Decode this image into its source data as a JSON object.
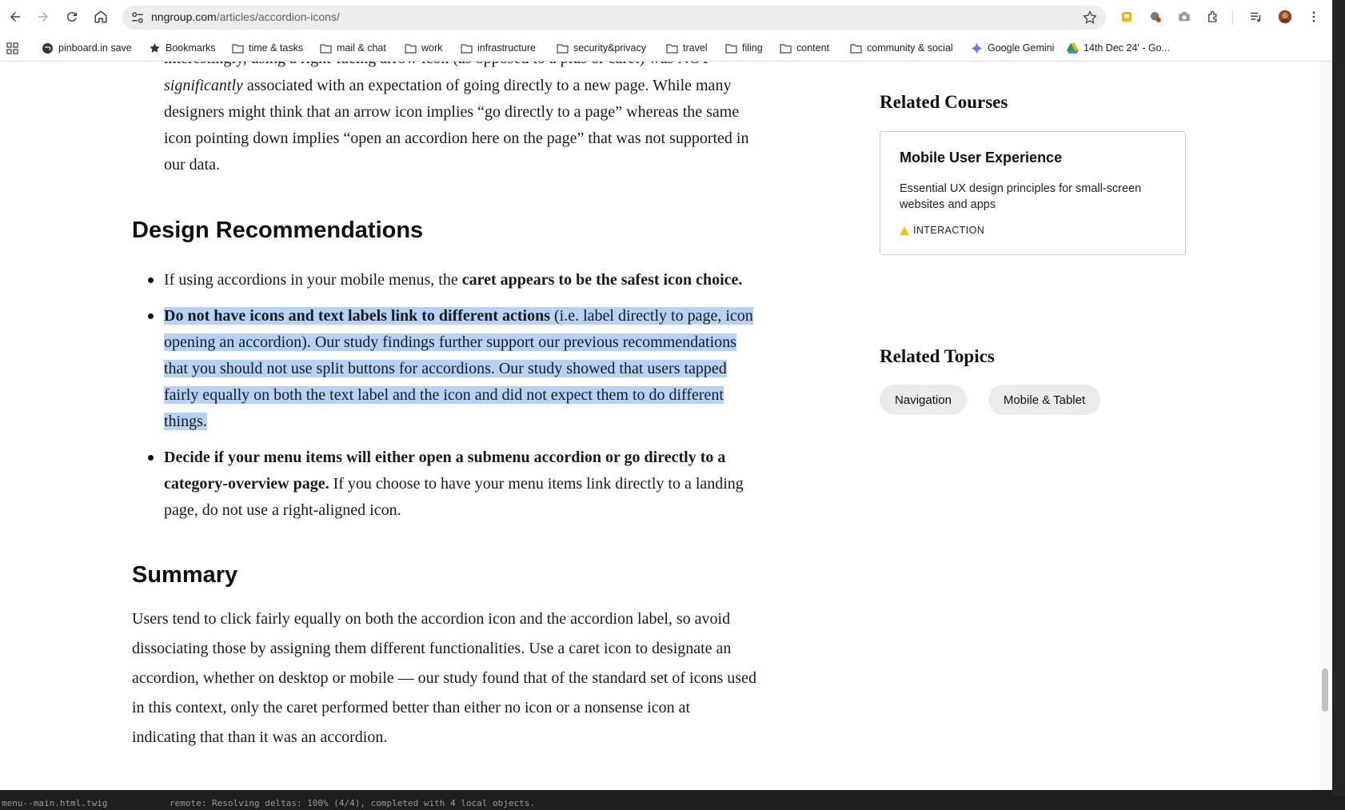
{
  "browser": {
    "url_host": "nngroup.com",
    "url_path": "/articles/accordion-icons/",
    "bookmarks": [
      {
        "label": "pinboard.in save",
        "icon": "globe-icon"
      },
      {
        "label": "Bookmarks",
        "icon": "star-icon"
      },
      {
        "label": "time & tasks",
        "icon": "folder-icon"
      },
      {
        "label": "mail & chat",
        "icon": "folder-icon"
      },
      {
        "label": "work",
        "icon": "folder-icon"
      },
      {
        "label": "infrastructure",
        "icon": "folder-icon"
      },
      {
        "label": "security&privacy",
        "icon": "folder-icon"
      },
      {
        "label": "travel",
        "icon": "folder-icon"
      },
      {
        "label": "filing",
        "icon": "folder-icon"
      },
      {
        "label": "content",
        "icon": "folder-icon"
      },
      {
        "label": "community & social",
        "icon": "folder-icon"
      },
      {
        "label": "Google Gemini",
        "icon": "gemini-icon"
      },
      {
        "label": "14th Dec 24' - Go...",
        "icon": "drive-icon"
      }
    ]
  },
  "article": {
    "top_line_partial": "interestingly, using a right-facing arrow icon (as opposed to a plus or caret) was NOT",
    "top_para_italic": "significantly",
    "top_para_rest1": " associated with an expectation of going directly to a new page.  While many",
    "top_para_line2": "designers might think that an arrow icon implies “go directly to a page” whereas the same",
    "top_para_line3": "icon pointing down implies “open an accordion here on the page” that was not supported in",
    "top_para_line4": "our data.",
    "design_heading": "Design Recommendations",
    "bullet1_prefix": "If using accordions in your mobile menus, the ",
    "bullet1_bold": "caret appears to be the safest icon choice.",
    "bullet2_bold": "Do not have icons and text labels link to different actions",
    "bullet2_l1_rest": " (i.e. label directly to page, icon",
    "bullet2_l2": "opening an accordion).  Our study findings further support our previous recommendations",
    "bullet2_l3": "that you should not use split buttons for accordions. Our study showed that users tapped",
    "bullet2_l4": "fairly equally on both the text label and the icon and did not expect them to do different",
    "bullet2_l5": "things.",
    "bullet3_bold_l1": "Decide if your menu items will either open a submenu accordion or go directly to a",
    "bullet3_bold_l2": "category-overview page.",
    "bullet3_l2_rest": "  If you choose to have your menu items link directly to a landing",
    "bullet3_l3": "page, do not use a right-aligned icon.",
    "summary_heading": "Summary",
    "summary_lines": [
      "Users tend to click fairly equally on both the accordion icon and the accordion label, so avoid",
      "dissociating those by assigning them different functionalities.  Use a caret icon to designate an",
      "accordion, whether on desktop or mobile — our study found that of the standard set of icons used",
      "in this context, only the caret performed better than either no icon or a nonsense icon at",
      "indicating that than it was an accordion."
    ]
  },
  "sidebar": {
    "courses_heading": "Related Courses",
    "course_title": "Mobile User Experience",
    "course_desc_l1": "Essential UX design principles for small-screen",
    "course_desc_l2": "websites and apps",
    "course_tag": "INTERACTION",
    "topics_heading": "Related Topics",
    "topics": [
      "Navigation",
      "Mobile & Tablet"
    ]
  },
  "terminal": {
    "left_text": "menu--main.html.twig",
    "right_text": "remote: Resolving deltas: 100% (4/4), completed with 4 local objects."
  },
  "colors": {
    "selection": "#b4d3f7",
    "tag_triangle": "#f5c400"
  }
}
